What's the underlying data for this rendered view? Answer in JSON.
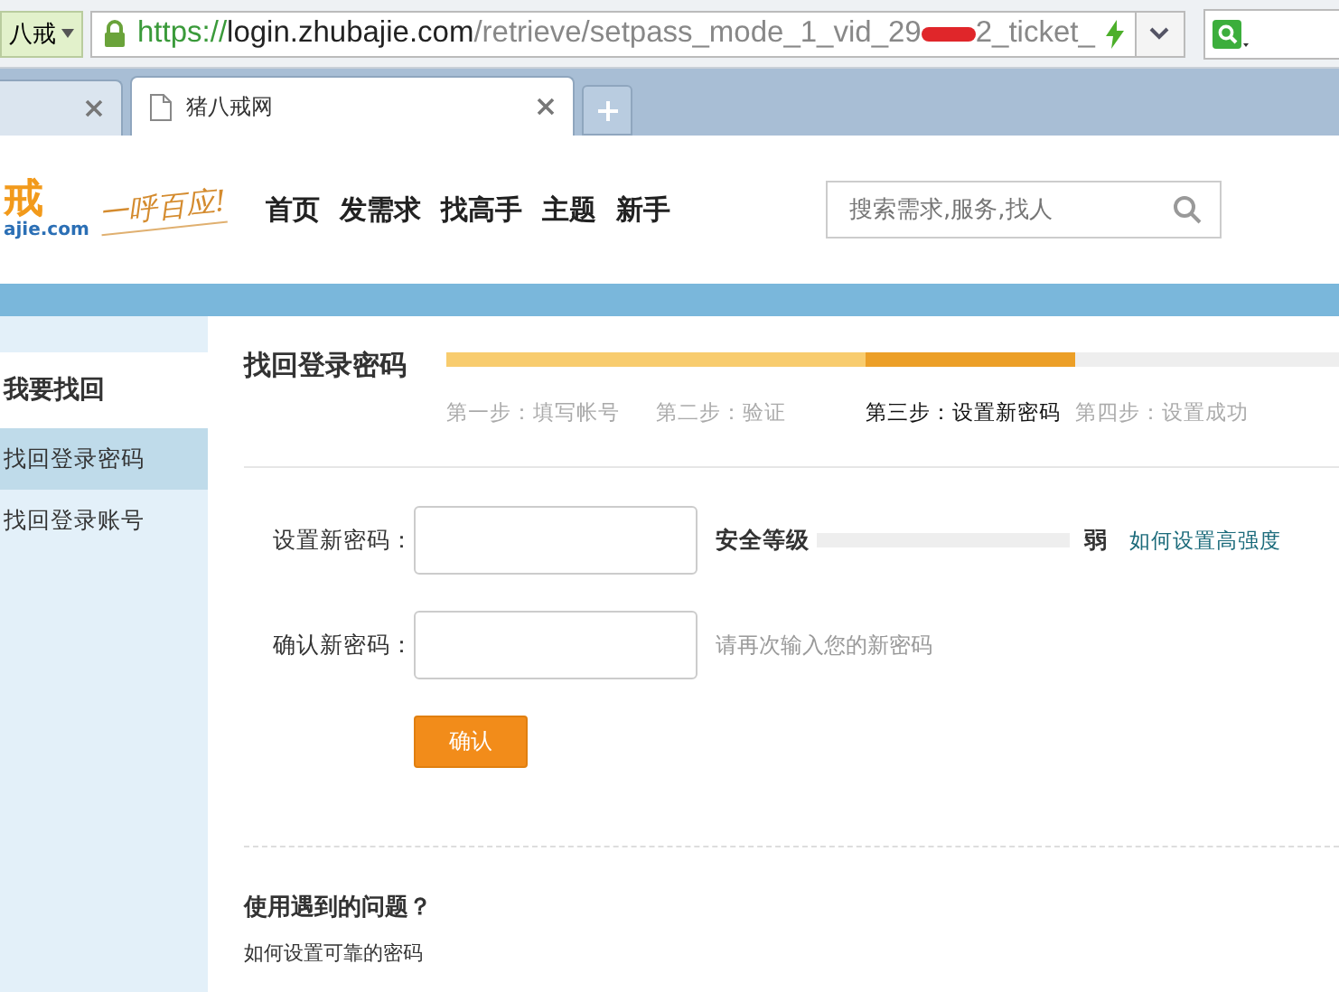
{
  "browser": {
    "profile": "八戒",
    "url": {
      "scheme": "https://",
      "host": "login.zhubajie.com",
      "path_before": "/retrieve/setpass_mode_1_vid_29",
      "path_after": "2_ticket_"
    },
    "tabs": [
      {
        "selected": false
      },
      {
        "label": "猪八戒网",
        "selected": true
      }
    ]
  },
  "header": {
    "logo": {
      "mark": "戒",
      "domain": "ajie.com",
      "slogan": "一呼百应!"
    },
    "nav": [
      "首页",
      "发需求",
      "找高手",
      "主题",
      "新手"
    ],
    "search": {
      "placeholder": "搜索需求,服务,找人"
    }
  },
  "sidebar": {
    "title": "我要找回",
    "items": [
      {
        "label": "找回登录密码",
        "selected": true
      },
      {
        "label": "找回登录账号",
        "selected": false
      }
    ]
  },
  "main": {
    "title": "找回登录密码",
    "steps": [
      {
        "label": "第一步：填写帐号",
        "done": true,
        "current": false
      },
      {
        "label": "第二步：验证",
        "done": true,
        "current": false
      },
      {
        "label": "第三步：设置新密码",
        "done": false,
        "current": true
      },
      {
        "label": "第四步：设置成功",
        "done": false,
        "current": false
      }
    ],
    "form": {
      "new_password_label": "设置新密码：",
      "strength_label": "安全等级",
      "strength": {
        "level": 0
      },
      "strength_reading": "弱",
      "strength_link": "如何设置高强度",
      "confirm_label": "确认新密码：",
      "confirm_hint": "请再次输入您的新密码",
      "submit": "确认"
    },
    "help": {
      "title": "使用遇到的问题？",
      "items": [
        "如何设置可靠的密码"
      ]
    }
  }
}
